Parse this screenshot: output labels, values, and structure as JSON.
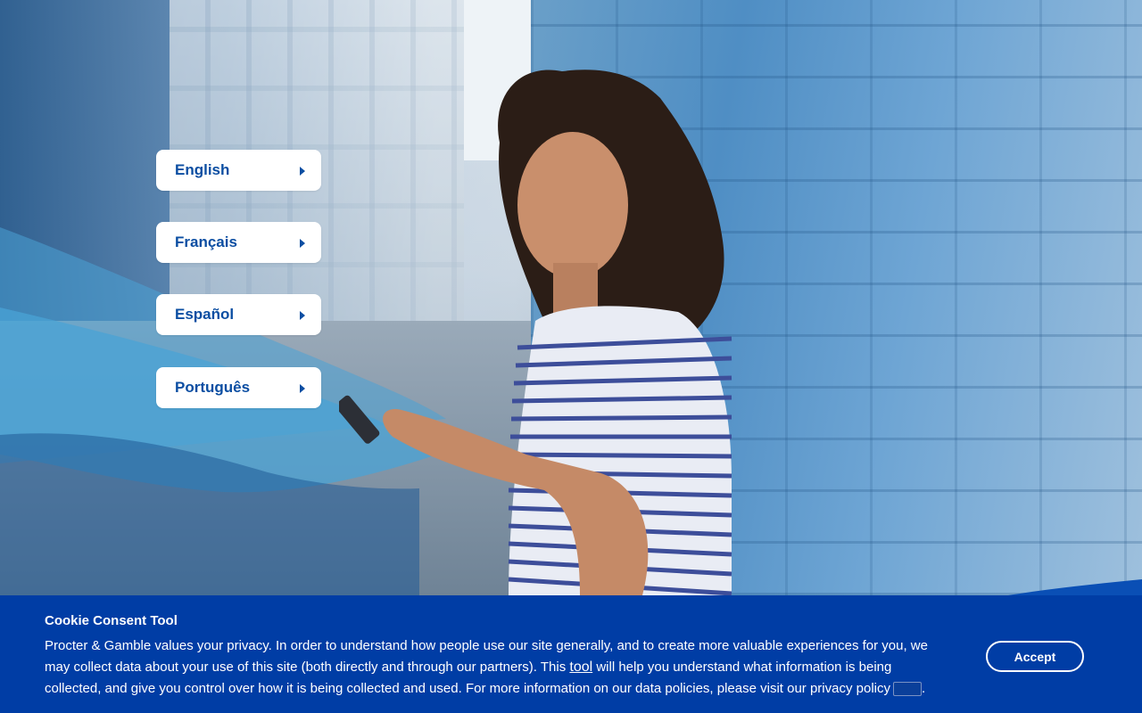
{
  "languages": [
    {
      "label": "English"
    },
    {
      "label": "Français"
    },
    {
      "label": "Español"
    },
    {
      "label": "Português"
    }
  ],
  "cookie": {
    "title": "Cookie Consent Tool",
    "text_part1": "Procter & Gamble values your privacy. In order to understand how people use our site generally, and to create more valuable experiences for you, we may collect data about your use of this site (both directly and through our partners). This ",
    "tool_link": "tool",
    "text_part2": " will help you understand what information is being collected, and give you control over how it is being collected and used. For more information on our data policies, please visit our privacy policy",
    "text_end": ".",
    "accept_label": "Accept"
  },
  "colors": {
    "banner": "#003da5",
    "button_text": "#0b4ea2",
    "wave_light": "#4aa3d6",
    "wave_dark": "#1f6fb2"
  },
  "icons": {
    "language_arrow": "caret-right-icon",
    "privacy_policy": "external-link-icon"
  }
}
